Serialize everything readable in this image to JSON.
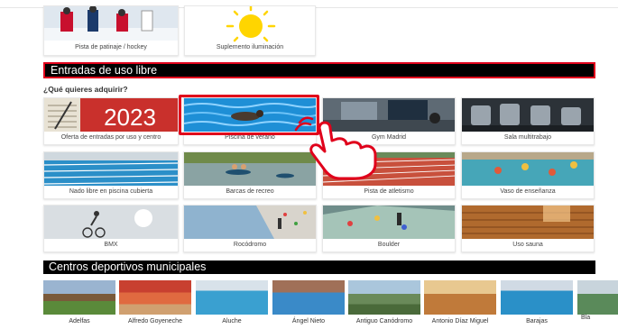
{
  "top_cards": [
    {
      "label": "Pista de patinaje / hockey",
      "icon": "ice-rink-photo"
    },
    {
      "label": "Suplemento iluminación",
      "icon": "sun-icon"
    }
  ],
  "section_free": {
    "title": "Entradas de uso libre",
    "question": "¿Qué quieres adquirir?",
    "items": [
      {
        "label": "Oferta de entradas por uso y centro"
      },
      {
        "label": "Piscina de verano"
      },
      {
        "label": "Gym Madrid"
      },
      {
        "label": "Sala multitrabajo"
      },
      {
        "label": "Nado libre en piscina cubierta"
      },
      {
        "label": "Barcas de recreo"
      },
      {
        "label": "Pista de atletismo"
      },
      {
        "label": "Vaso de enseñanza"
      },
      {
        "label": "BMX"
      },
      {
        "label": "Rocódromo"
      },
      {
        "label": "Boulder"
      },
      {
        "label": "Uso sauna"
      }
    ],
    "calendar_text": "2023"
  },
  "section_centers": {
    "title": "Centros deportivos municipales",
    "items": [
      {
        "label": "Adelfas"
      },
      {
        "label": "Alfredo Goyeneche"
      },
      {
        "label": "Aluche"
      },
      {
        "label": "Ángel Nieto"
      },
      {
        "label": "Antiguo Canódromo"
      },
      {
        "label": "Antonio Díaz Miguel"
      },
      {
        "label": "Barajas"
      },
      {
        "label": "Bla"
      }
    ]
  },
  "colors": {
    "highlight": "#e0001b",
    "band": "#000000"
  },
  "cursor_icon": "hand-pointer-icon"
}
